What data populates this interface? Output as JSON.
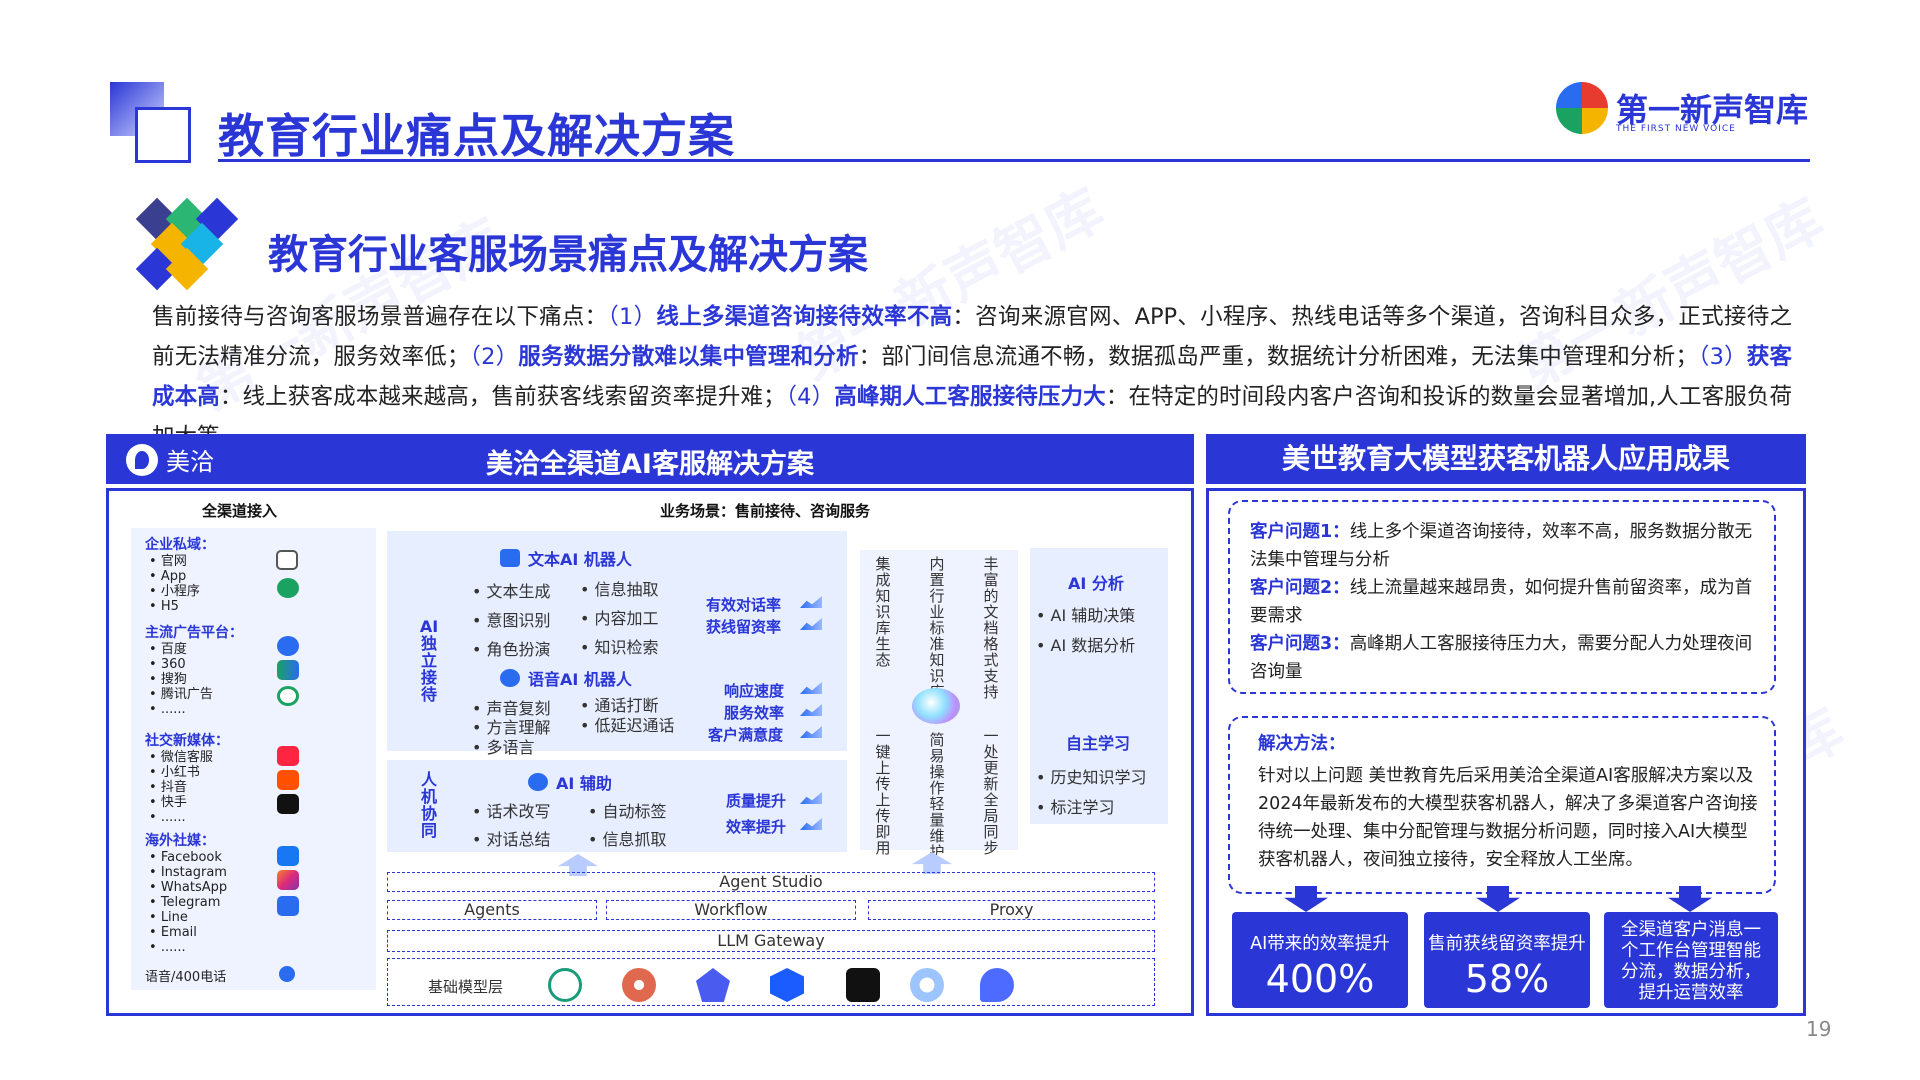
{
  "header": {
    "title": "教育行业痛点及解决方案",
    "logo_name": "第一新声智库",
    "logo_sub": "THE FIRST NEW VOICE"
  },
  "subtitle": "教育行业客服场景痛点及解决方案",
  "intro": {
    "lead": "售前接待与咨询客服场景普遍存在以下痛点：",
    "p1_num": "（1）",
    "p1_title": "线上多渠道咨询接待效率不高",
    "p1_text": "：咨询来源官网、APP、小程序、热线电话等多个渠道，咨询科目众多，正式接待之前无法精准分流，服务效率低；",
    "p2_num": "（2）",
    "p2_title": "服务数据分散难以集中管理和分析",
    "p2_text": "：部门间信息流通不畅，数据孤岛严重，数据统计分析困难，无法集中管理和分析；",
    "p3_num": "（3）",
    "p3_title": "获客成本高",
    "p3_text": "：线上获客成本越来越高，售前获客线索留资率提升难；",
    "p4_num": "（4）",
    "p4_title": "高峰期人工客服接待压力大",
    "p4_text": "：在特定的时间段内客户咨询和投诉的数量会显著增加,人工客服负荷加大等。"
  },
  "left_panel": {
    "brand": "美洽",
    "title": "美洽全渠道AI客服解决方案",
    "channels_header": "全渠道接入",
    "scene_header": "业务场景：售前接待、咨询服务",
    "channel_groups": [
      {
        "title": "企业私域：",
        "items": [
          "官网",
          "App",
          "小程序",
          "H5"
        ]
      },
      {
        "title": "主流广告平台：",
        "items": [
          "百度",
          "360",
          "搜狗",
          "腾讯广告",
          "......"
        ]
      },
      {
        "title": "社交新媒体：",
        "items": [
          "微信客服",
          "小红书",
          "抖音",
          "快手",
          "......"
        ]
      },
      {
        "title": "海外社媒：",
        "items": [
          "Facebook",
          "Instagram",
          "WhatsApp",
          "Telegram",
          "Line",
          "Email",
          "......"
        ]
      }
    ],
    "phone_channel": "语音/400电话",
    "ai_independent_label": "AI独立接待",
    "human_label": "人机协同",
    "text_ai": {
      "title": "文本AI 机器人",
      "items": [
        "文本生成",
        "信息抽取",
        "意图识别",
        "内容加工",
        "角色扮演",
        "知识检索"
      ]
    },
    "voice_ai": {
      "title": "语音AI 机器人",
      "items": [
        "声音复刻",
        "通话打断",
        "方言理解",
        "低延迟通话",
        "多语言"
      ]
    },
    "ai_assist": {
      "title": "AI 辅助",
      "items": [
        "话术改写",
        "自动标签",
        "对话总结",
        "信息抓取"
      ]
    },
    "metrics": [
      "有效对话率",
      "获线留资率",
      "响应速度",
      "服务效率",
      "客户满意度",
      "质量提升",
      "效率提升"
    ],
    "vertical_cols": [
      {
        "top": "集成知识库生态",
        "bottom": "一键上传 上传即用"
      },
      {
        "top": "内置行业标准知识库",
        "bottom": "简易操作 轻量维护"
      },
      {
        "top": "丰富的文档格式支持",
        "bottom": "一处更新 全局同步"
      }
    ],
    "ai_analysis": {
      "title": "AI 分析",
      "items": [
        "AI 辅助决策",
        "AI 数据分析"
      ]
    },
    "self_learning": {
      "title": "自主学习",
      "items": [
        "历史知识学习",
        "标注学习"
      ]
    },
    "platform": {
      "agent_studio": "Agent  Studio",
      "agents": "Agents",
      "workflow": "Workflow",
      "proxy": "Proxy",
      "llm_gateway": "LLM Gateway",
      "base_layer": "基础模型层"
    },
    "model_icons": [
      "openai-icon",
      "claude-icon",
      "zhipu-icon",
      "model-cube-icon",
      "kimi-icon",
      "doubao-icon",
      "deepseek-icon"
    ]
  },
  "right_panel": {
    "title": "美世教育大模型获客机器人应用成果",
    "q1_label": "客户问题1：",
    "q1_text": "线上多个渠道咨询接待，效率不高，服务数据分散无法集中管理与分析",
    "q2_label": "客户问题2：",
    "q2_text": "线上流量越来越昂贵，如何提升售前留资率，成为首要需求",
    "q3_label": "客户问题3：",
    "q3_text": "高峰期人工客服接待压力大，需要分配人力处理夜间咨询量",
    "solution_label": "解决方法：",
    "solution_text": "针对以上问题 美世教育先后采用美洽全渠道AI客服解决方案以及2024年最新发布的大模型获客机器人，解决了多渠道客户咨询接待统一处理、集中分配管理与数据分析问题，同时接入AI大模型获客机器人，夜间独立接待，安全释放人工坐席。",
    "cards": [
      {
        "label": "AI带来的效率提升",
        "value": "400%"
      },
      {
        "label": "售前获线留资率提升",
        "value": "58%"
      },
      {
        "label": "全渠道客户消息一个工作台管理智能分流，数据分析，提升运营效率",
        "value": ""
      }
    ]
  },
  "page_number": "19",
  "colors": {
    "primary": "#2a36d6",
    "text": "#222222",
    "panel_bg": "#e7eeff"
  }
}
